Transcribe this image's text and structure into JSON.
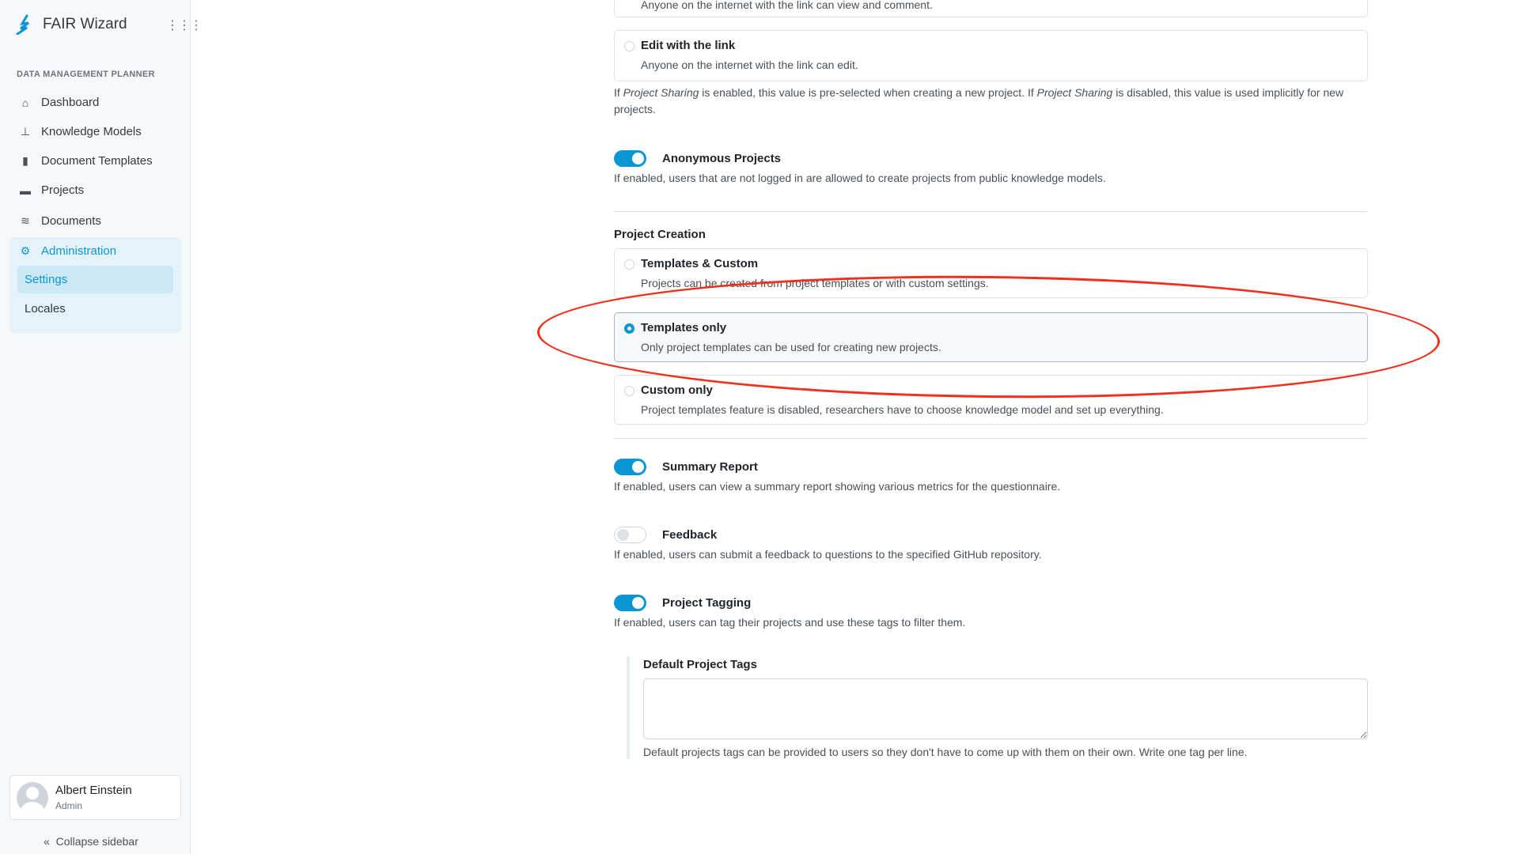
{
  "app": {
    "title": "FAIR Wizard",
    "brand_color": "#0a95d5"
  },
  "sidebar": {
    "section": "DATA MANAGEMENT PLANNER",
    "items": [
      {
        "label": "Dashboard",
        "icon": "home-icon"
      },
      {
        "label": "Knowledge Models",
        "icon": "sitemap-icon"
      },
      {
        "label": "Document Templates",
        "icon": "file-code-icon"
      },
      {
        "label": "Projects",
        "icon": "folder-icon"
      },
      {
        "label": "Documents",
        "icon": "layers-icon"
      },
      {
        "label": "Administration",
        "icon": "gear-icon"
      }
    ],
    "sub_items": [
      {
        "label": "Settings",
        "active": true
      },
      {
        "label": "Locales"
      }
    ],
    "user": {
      "name": "Albert Einstein",
      "role": "Admin"
    },
    "collapse": "Collapse sidebar"
  },
  "sharing": {
    "prev_desc": "Anyone on the internet with the link can view and comment.",
    "edit_title": "Edit with the link",
    "edit_desc": "Anyone on the internet with the link can edit.",
    "help_1": "If ",
    "help_em1": "Project Sharing",
    "help_2": " is enabled, this value is pre-selected when creating a new project. If ",
    "help_em2": "Project Sharing",
    "help_3": " is disabled, this value is used implicitly for new projects."
  },
  "anonymous": {
    "label": "Anonymous Projects",
    "enabled": true,
    "desc": "If enabled, users that are not logged in are allowed to create projects from public knowledge models."
  },
  "creation": {
    "heading": "Project Creation",
    "options": [
      {
        "title": "Templates & Custom",
        "desc": "Projects can be created from project templates or with custom settings.",
        "selected": false
      },
      {
        "title": "Templates only",
        "desc": "Only project templates can be used for creating new projects.",
        "selected": true
      },
      {
        "title": "Custom only",
        "desc": "Project templates feature is disabled, researchers have to choose knowledge model and set up everything.",
        "selected": false
      }
    ]
  },
  "summary": {
    "label": "Summary Report",
    "enabled": true,
    "desc": "If enabled, users can view a summary report showing various metrics for the questionnaire."
  },
  "feedback": {
    "label": "Feedback",
    "enabled": false,
    "desc": "If enabled, users can submit a feedback to questions to the specified GitHub repository."
  },
  "tagging": {
    "label": "Project Tagging",
    "enabled": true,
    "desc": "If enabled, users can tag their projects and use these tags to filter them.",
    "tags_label": "Default Project Tags",
    "tags_value": "",
    "tags_help": "Default projects tags can be provided to users so they don't have to come up with them on their own. Write one tag per line."
  },
  "annotation": {
    "color": "#f0301c",
    "shape": "ellipse"
  }
}
